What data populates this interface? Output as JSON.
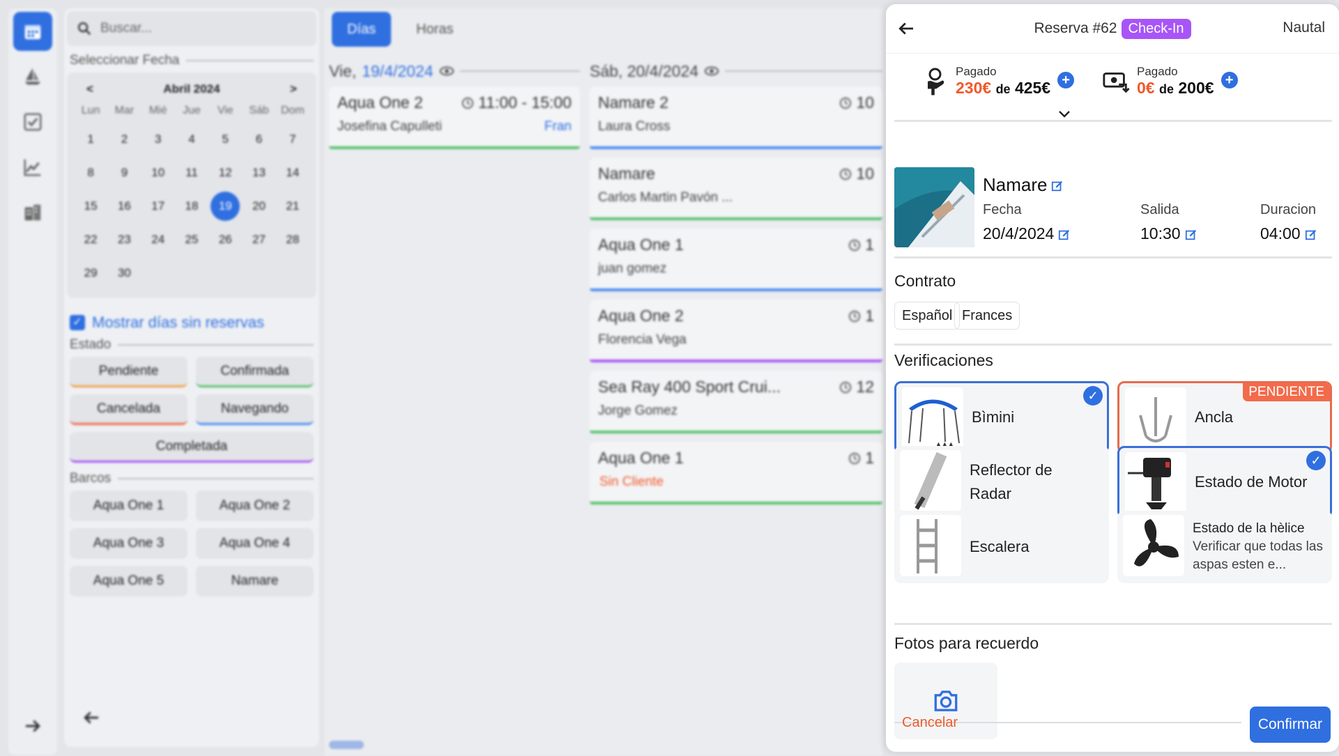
{
  "rail": {
    "icons": [
      "calendar-icon",
      "sailboat-icon",
      "checklist-icon",
      "chart-icon",
      "building-icon"
    ],
    "expand": "arrow-right-icon"
  },
  "sidebar": {
    "search_placeholder": "Buscar...",
    "select_date": "Seleccionar Fecha",
    "calendar": {
      "prev": "<",
      "next": ">",
      "month": "Abril 2024",
      "weekdays": [
        "Lun",
        "Mar",
        "Mié",
        "Jue",
        "Vie",
        "Sáb",
        "Dom"
      ],
      "days": [
        "1",
        "2",
        "3",
        "4",
        "5",
        "6",
        "7",
        "8",
        "9",
        "10",
        "11",
        "12",
        "13",
        "14",
        "15",
        "16",
        "17",
        "18",
        "19",
        "20",
        "21",
        "22",
        "23",
        "24",
        "25",
        "26",
        "27",
        "28",
        "29",
        "30"
      ],
      "selected": "19"
    },
    "show_empty": "Mostrar días sin reservas",
    "estado": "Estado",
    "estados": [
      {
        "label": "Pendiente",
        "color": "#f0a14a"
      },
      {
        "label": "Confirmada",
        "color": "#57c26b"
      },
      {
        "label": "Cancelada",
        "color": "#ef6a4a"
      },
      {
        "label": "Navegando",
        "color": "#4a8bf0"
      },
      {
        "label": "Completada",
        "color": "#a855f7"
      }
    ],
    "barcos_title": "Barcos",
    "barcos": [
      "Aqua One 1",
      "Aqua One 2",
      "Aqua One 3",
      "Aqua One 4",
      "Aqua One 5",
      "Namare"
    ]
  },
  "main": {
    "tabs": [
      "Días",
      "Horas"
    ],
    "col1": {
      "day": "Vie,",
      "date": "19/4/2024",
      "cards": [
        {
          "boat": "Aqua One 2",
          "time": "11:00 - 15:00",
          "client": "Josefina Capulleti",
          "staff": "Fran",
          "color": "#57c26b"
        }
      ]
    },
    "col2": {
      "day": "Sáb, 20/4/2024",
      "cards": [
        {
          "boat": "Namare 2",
          "time": "10",
          "client": "Laura Cross",
          "color": "#4a8bf0"
        },
        {
          "boat": "Namare",
          "time": "10",
          "client": "Carlos Martin Pavón ...",
          "color": "#57c26b"
        },
        {
          "boat": "Aqua One 1",
          "time": "1",
          "client": "juan gomez",
          "color": "#4a8bf0"
        },
        {
          "boat": "Aqua One 2",
          "time": "1",
          "client": "Florencia Vega",
          "color": "#a855f7"
        },
        {
          "boat": "Sea Ray 400 Sport Crui...",
          "time": "12",
          "client": "Jorge Gomez",
          "color": "#57c26b"
        },
        {
          "boat": "Aqua One 1",
          "time": "1",
          "client": "Sin Cliente",
          "color": "#57c26b"
        }
      ]
    }
  },
  "panel": {
    "title": "Reserva #62",
    "status": "Check-In",
    "brand": "Nautal",
    "pay1": {
      "label": "Pagado",
      "paid": "230€",
      "de": "de",
      "total": "425€"
    },
    "pay2": {
      "label": "Pagado",
      "paid": "0€",
      "de": "de",
      "total": "200€"
    },
    "boat": {
      "name": "Namare",
      "fecha_label": "Fecha",
      "fecha": "20/4/2024",
      "salida_label": "Salida",
      "salida": "10:30",
      "duracion_label": "Duracion",
      "duracion": "04:00"
    },
    "contrato": "Contrato",
    "langs": [
      "Español",
      "Frances"
    ],
    "verificaciones": "Verificaciones",
    "checks": [
      {
        "label": "Bìmini",
        "state": "ok"
      },
      {
        "label": "Ancla",
        "state": "pend",
        "tag": "PENDIENTE"
      },
      {
        "label": "Reflector de Radar",
        "state": "none"
      },
      {
        "label": "Estado de Motor",
        "state": "ok"
      },
      {
        "label": "Escalera",
        "state": "none"
      },
      {
        "label": "Estado de la hèlice",
        "desc": "Verificar que todas las aspas esten e...",
        "state": "none"
      }
    ],
    "fotos": "Fotos para recuerdo",
    "cancel": "Cancelar",
    "confirm": "Confirmar"
  }
}
